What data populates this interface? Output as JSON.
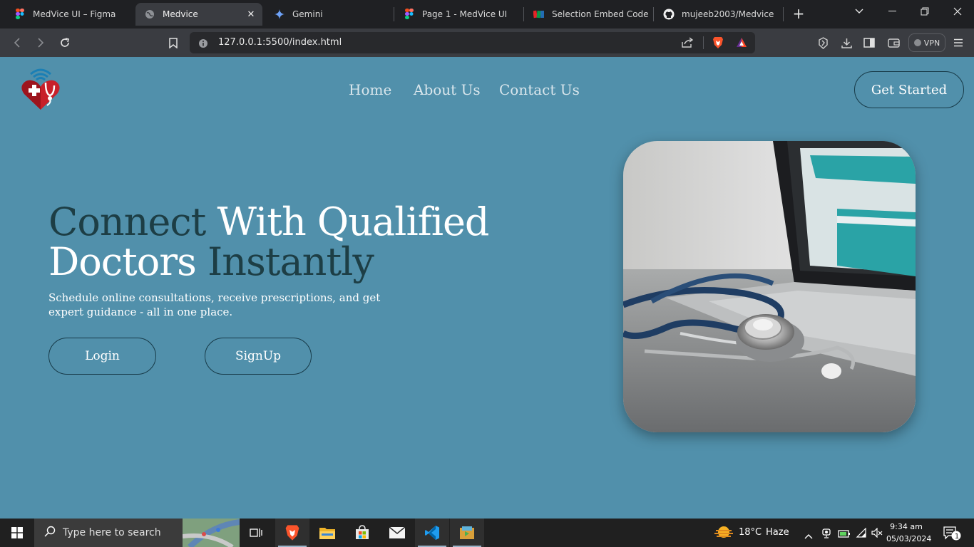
{
  "browser": {
    "tabs": [
      {
        "title": "MedVice UI – Figma",
        "icon": "figma-icon"
      },
      {
        "title": "Medvice",
        "icon": "globe-icon"
      },
      {
        "title": "Gemini",
        "icon": "gemini-icon"
      },
      {
        "title": "Page 1 - MedVice UI",
        "icon": "figma-icon"
      },
      {
        "title": "Selection Embed Code - G",
        "icon": "zoho-icon"
      },
      {
        "title": "mujeeb2003/Medvice",
        "icon": "github-icon"
      }
    ],
    "url": "127.0.0.1:5500/index.html",
    "vpn_label": "VPN"
  },
  "page": {
    "nav": {
      "home": "Home",
      "about": "About Us",
      "contact": "Contact Us"
    },
    "get_started": "Get Started",
    "headline": {
      "w1": "Connect",
      "w2": "With Qualified",
      "w3": "Doctors",
      "w4": "Instantly"
    },
    "subtext": "Schedule online consultations, receive prescriptions, and get expert guidance - all in one place.",
    "login": "Login",
    "signup": "SignUp"
  },
  "taskbar": {
    "search_placeholder": "Type here to search",
    "weather": "18°C",
    "weather_desc": "Haze",
    "time": "9:34 am",
    "date": "05/03/2024",
    "notifications": "1"
  },
  "colors": {
    "page_bg": "#5190ab",
    "headline_dark": "#1d3e45",
    "button_border": "#173a48"
  }
}
